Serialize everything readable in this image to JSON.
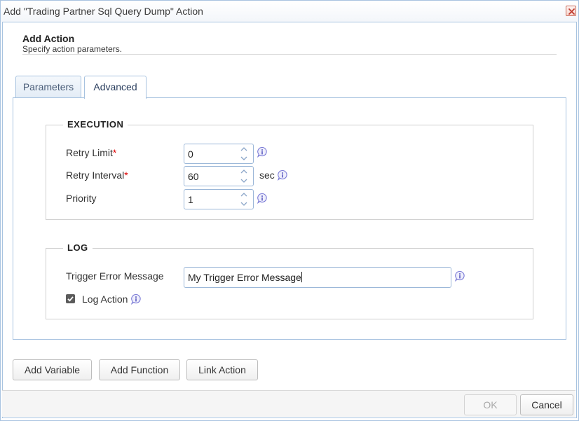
{
  "dialog": {
    "title": "Add \"Trading Partner Sql Query Dump\" Action",
    "header_title": "Add Action",
    "header_subtitle": "Specify action parameters."
  },
  "tabs": [
    {
      "label": "Parameters",
      "active": false
    },
    {
      "label": "Advanced",
      "active": true
    }
  ],
  "execution": {
    "legend": "EXECUTION",
    "retry_limit": {
      "label": "Retry Limit",
      "required_mark": "*",
      "value": "0"
    },
    "retry_interval": {
      "label": "Retry Interval",
      "required_mark": "*",
      "value": "60",
      "unit": "sec"
    },
    "priority": {
      "label": "Priority",
      "value": "1"
    }
  },
  "log": {
    "legend": "LOG",
    "trigger_error_message": {
      "label": "Trigger Error Message",
      "value": "My Trigger Error Message"
    },
    "log_action": {
      "label": "Log Action",
      "checked": true
    }
  },
  "actions": {
    "add_variable": "Add Variable",
    "add_function": "Add Function",
    "link_action": "Link Action"
  },
  "footer": {
    "ok": "OK",
    "cancel": "Cancel"
  },
  "colors": {
    "accent_border": "#a8c3e0",
    "required": "#dd0000",
    "info_icon": "#7a7ad6"
  }
}
